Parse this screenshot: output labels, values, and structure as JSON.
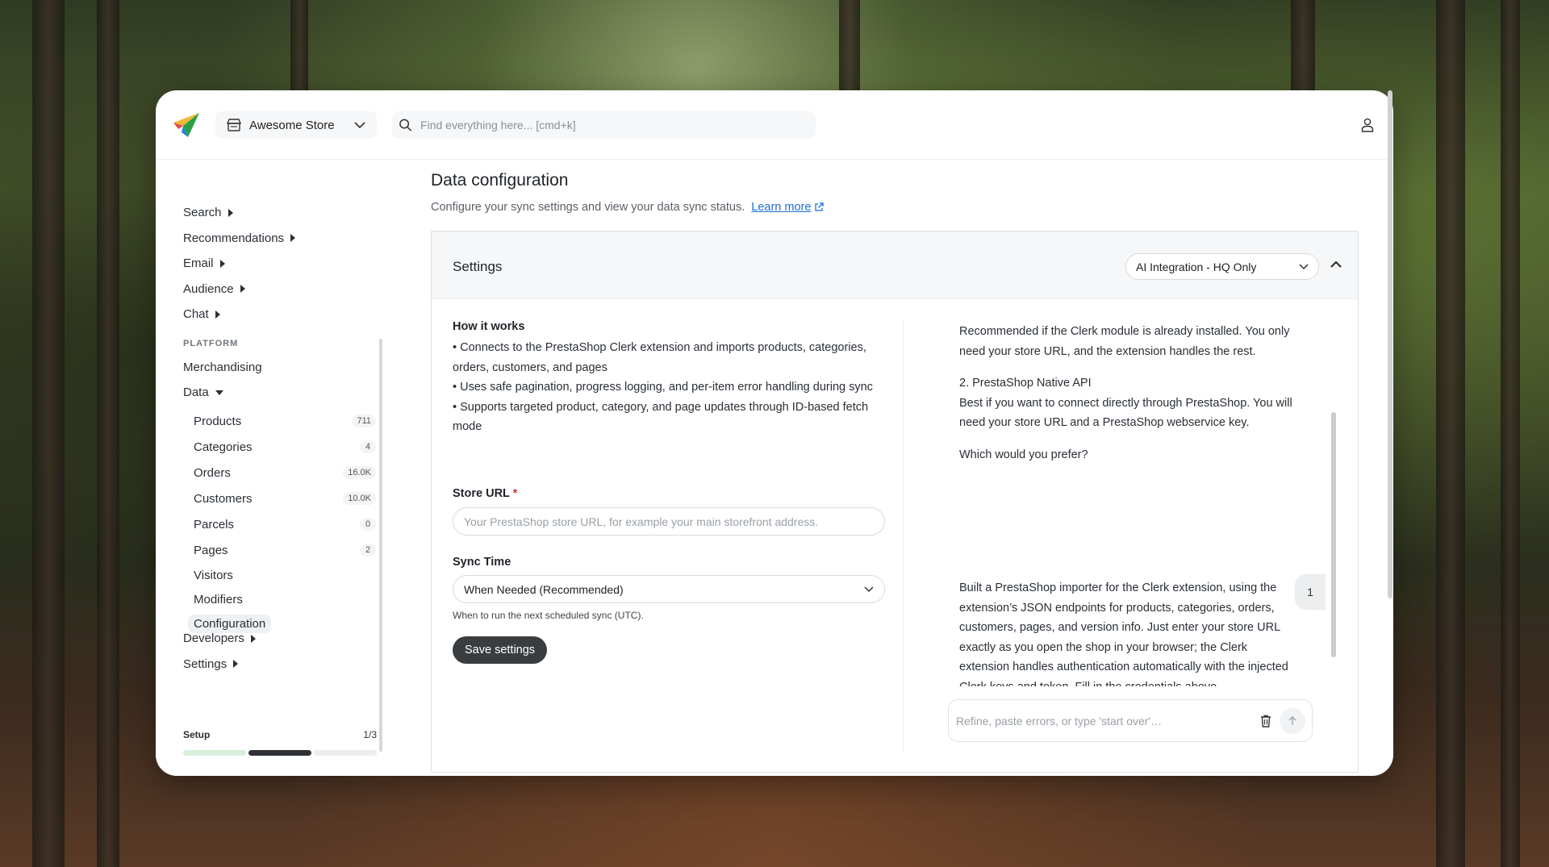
{
  "app": {
    "store_name": "Awesome Store",
    "search_placeholder": "Find everything here... [cmd+k]"
  },
  "sidebar": {
    "top_items": [
      {
        "label": "Search"
      },
      {
        "label": "Recommendations"
      },
      {
        "label": "Email"
      },
      {
        "label": "Audience"
      },
      {
        "label": "Chat"
      }
    ],
    "section_label": "PLATFORM",
    "merchandising": "Merchandising",
    "data_label": "Data",
    "data_items": [
      {
        "label": "Products",
        "count": "711"
      },
      {
        "label": "Categories",
        "count": "4"
      },
      {
        "label": "Orders",
        "count": "16.0K"
      },
      {
        "label": "Customers",
        "count": "10.0K"
      },
      {
        "label": "Parcels",
        "count": "0"
      },
      {
        "label": "Pages",
        "count": "2"
      },
      {
        "label": "Visitors"
      },
      {
        "label": "Modifiers"
      },
      {
        "label": "Configuration"
      }
    ],
    "bottom_items": [
      {
        "label": "Developers"
      },
      {
        "label": "Settings"
      }
    ],
    "setup": {
      "label": "Setup",
      "count": "1/3",
      "progress_fraction": 0.333,
      "colors": [
        "#d7f0dc",
        "#2e3135",
        "#eceef0"
      ]
    }
  },
  "page": {
    "title": "Data configuration",
    "subtitle": "Configure your sync settings and view your data sync status.",
    "learn_more": "Learn more"
  },
  "card": {
    "title": "Settings",
    "integration_select": "AI Integration - HQ Only",
    "how_title": "How it works",
    "how_items": [
      "• Connects to the PrestaShop Clerk extension and imports products, categories, orders, customers, and pages",
      "• Uses safe pagination, progress logging, and per-item error handling during sync",
      "• Supports targeted product, category, and page updates through ID-based fetch mode"
    ],
    "store_url_label": "Store URL",
    "store_url_required": "*",
    "store_url_placeholder": "Your PrestaShop store URL, for example your main storefront address.",
    "sync_time_label": "Sync Time",
    "sync_time_value": "When Needed (Recommended)",
    "sync_time_help": "When to run the next scheduled sync (UTC).",
    "save_label": "Save settings"
  },
  "chat": {
    "msg1_p1": "Recommended if the Clerk module is already installed. You only need your store URL, and the extension handles the rest.",
    "msg1_p2_title": "2. PrestaShop Native API",
    "msg1_p2_body": "Best if you want to connect directly through PrestaShop. You will need your store URL and a PrestaShop webservice key.",
    "msg1_p3": "Which would you prefer?",
    "user_reply": "1",
    "msg2": "Built a PrestaShop importer for the Clerk extension, using the extension’s JSON endpoints for products, categories, orders, customers, pages, and version info. Just enter your store URL exactly as you open the shop in your browser; the Clerk extension handles authentication automatically with the injected Clerk keys and token. Fill in the credentials above",
    "input_placeholder": "Refine, paste errors, or type 'start over'…"
  },
  "colors": {
    "link": "#1a6fd1",
    "primary_button": "#3a3d40",
    "required": "#d0343a"
  }
}
